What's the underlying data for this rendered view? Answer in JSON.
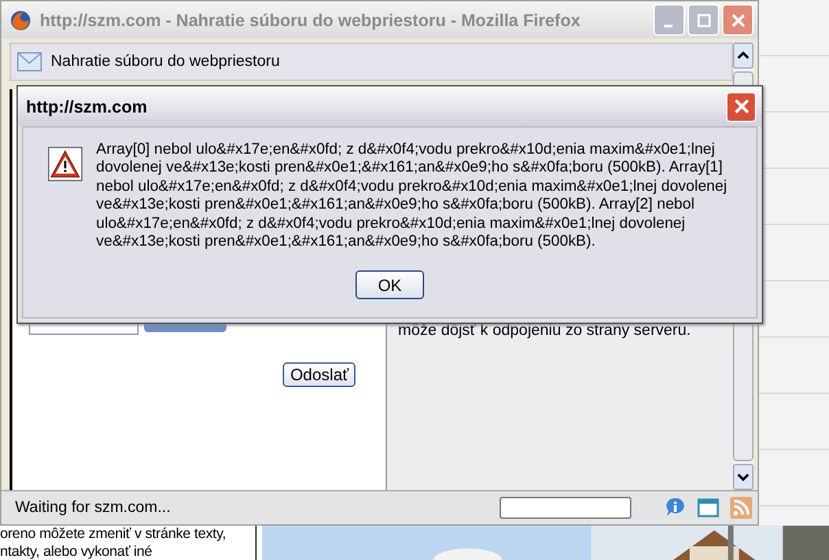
{
  "popup_window": {
    "title": "http://szm.com - Nahratie súboru do webpriestoru - Mozilla Firefox",
    "toolbar_label": "Nahratie súboru do webpriestoru",
    "send_button": "Odoslať",
    "right_panel_text": "môže dôjsť k odpojeniu zo strany serveru.",
    "status_text": "Waiting for szm.com..."
  },
  "dialog": {
    "title": "http://szm.com",
    "message": "Array[0] nebol ulo&#x17e;en&#x0fd; z d&#x0f4;vodu prekro&#x10d;enia maxim&#x0e1;lnej dovolenej ve&#x13e;kosti pren&#x0e1;&#x161;an&#x0e9;ho s&#x0fa;boru (500kB). Array[1] nebol ulo&#x17e;en&#x0fd; z d&#x0f4;vodu prekro&#x10d;enia maxim&#x0e1;lnej dovolenej ve&#x13e;kosti pren&#x0e1;&#x161;an&#x0e9;ho s&#x0fa;boru (500kB). Array[2] nebol ulo&#x17e;en&#x0fd; z d&#x0f4;vodu prekro&#x10d;enia maxim&#x0e1;lnej dovolenej ve&#x13e;kosti pren&#x0e1;&#x161;an&#x0e9;ho s&#x0fa;boru (500kB).",
    "ok_button": "OK"
  },
  "background_page": {
    "text_lines": [
      "oreno môžete zmeniť v stránke texty,",
      "ntakty, alebo vykonať iné"
    ]
  }
}
